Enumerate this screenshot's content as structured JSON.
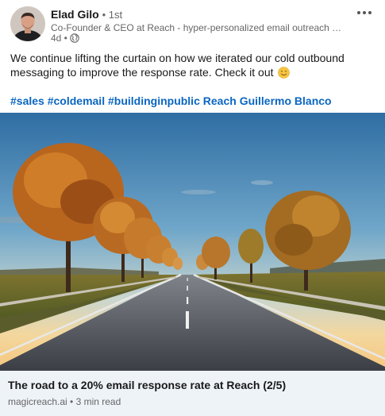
{
  "author": {
    "name": "Elad Gilo",
    "degree": "• 1st",
    "headline": "Co-Founder & CEO at Reach - hyper-personalized email outreach at sc...",
    "time": "4d •",
    "visibility_icon": "globe-icon"
  },
  "post": {
    "text": "We continue lifting the curtain on how we iterated our cold outbound messaging to improve the response rate. Check it out",
    "emoji": "smiling-face",
    "hashtags": [
      "#sales",
      "#coldemail",
      "#buildinginpublic",
      "Reach",
      "Guillermo Blanco"
    ]
  },
  "link_card": {
    "title": "The road to a 20% email response rate at Reach (2/5)",
    "source": "magicreach.ai • 3 min read"
  },
  "colors": {
    "link": "#0a66c2",
    "card_bg": "#eef3f8",
    "muted_text": "#666666"
  }
}
